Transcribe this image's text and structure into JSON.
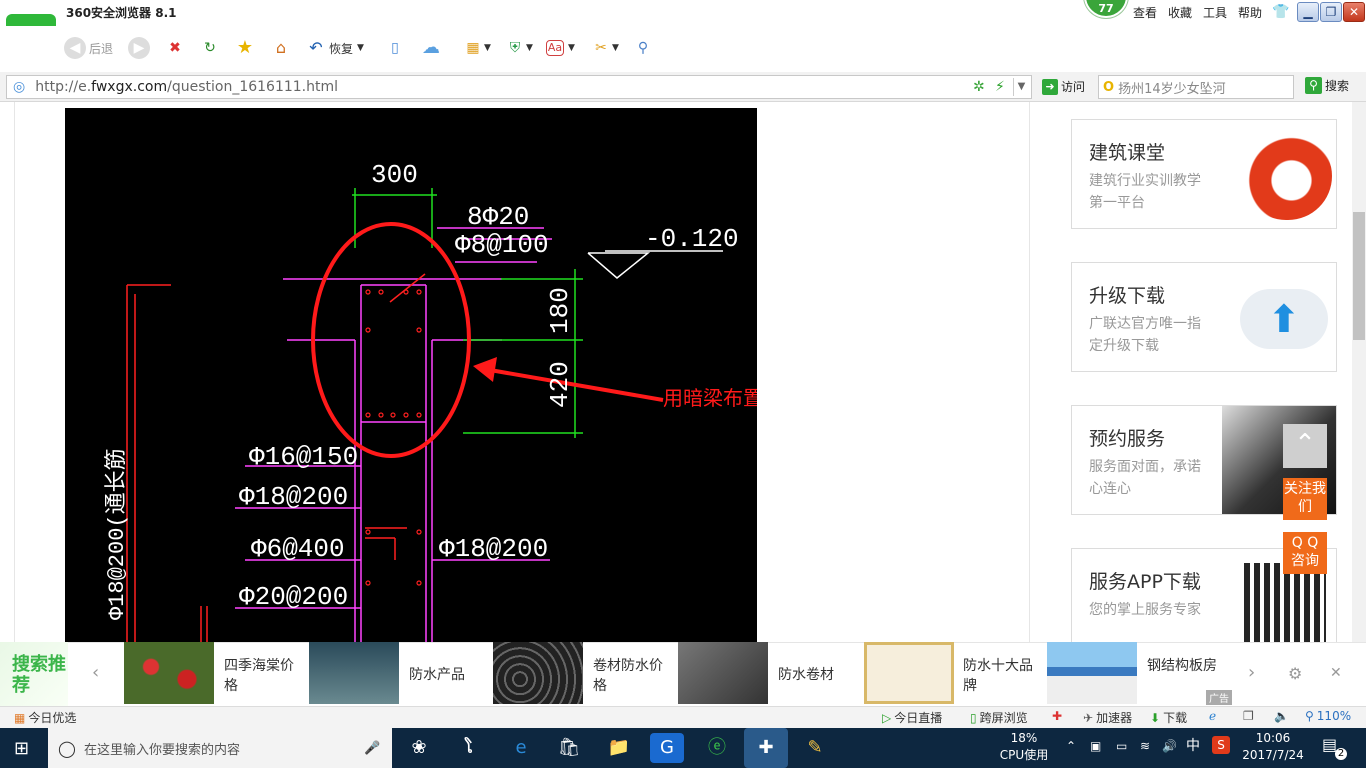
{
  "browser": {
    "title": "360安全浏览器 8.1",
    "badge": "77",
    "title_links": [
      "查看",
      "收藏",
      "工具",
      "帮助"
    ],
    "back_label": "后退",
    "restore_label": "恢复",
    "url_prefix": "http://e.",
    "url_host": "fwxgx.com",
    "url_path": "/question_1616111.html",
    "visit_label": "访问",
    "search_text": "扬州14岁少女坠河",
    "search_button": "搜索"
  },
  "drawing": {
    "dim_300": "300",
    "rebar_top": "8Φ20",
    "stirrup_top": "Φ8@100",
    "elevation": "-0.120",
    "dim_180": "180",
    "dim_420": "420",
    "annotation": "用暗梁布置",
    "rebar_1": "Φ16@150",
    "rebar_2": "Φ18@200",
    "rebar_3": "Φ6@400",
    "rebar_4": "Φ18@200",
    "rebar_5": "Φ20@200",
    "vertical_label": "Φ18@200(通长筋"
  },
  "sidebar": {
    "cards": [
      {
        "title": "建筑课堂",
        "desc": "建筑行业实训教学第一平台"
      },
      {
        "title": "升级下载",
        "desc": "广联达官方唯一指定升级下载"
      },
      {
        "title": "预约服务",
        "desc": "服务面对面，承诺心连心"
      },
      {
        "title": "服务APP下载",
        "desc": "您的掌上服务专家"
      }
    ],
    "follow_label": "关注我们",
    "qq_label": "Q Q 咨询"
  },
  "promo": {
    "title": "搜索推荐",
    "items": [
      "四季海棠价格",
      "防水产品",
      "卷材防水价格",
      "防水卷材",
      "防水十大品牌",
      "钢结构板房"
    ],
    "ad_label": "广告"
  },
  "status": {
    "left": "今日优选",
    "live": "今日直播",
    "cross": "跨屏浏览",
    "accel": "加速器",
    "download": "下载",
    "zoom": "110%"
  },
  "taskbar": {
    "search_placeholder": "在这里输入你要搜索的内容",
    "cpu_value": "18%",
    "cpu_label": "CPU使用",
    "ime": "中",
    "time": "10:06",
    "date": "2017/7/24",
    "notify_count": "2"
  },
  "colors": {
    "brand_green": "#2fb83a",
    "accent_orange": "#f06a1a",
    "cad_red": "#ff1a1a"
  }
}
